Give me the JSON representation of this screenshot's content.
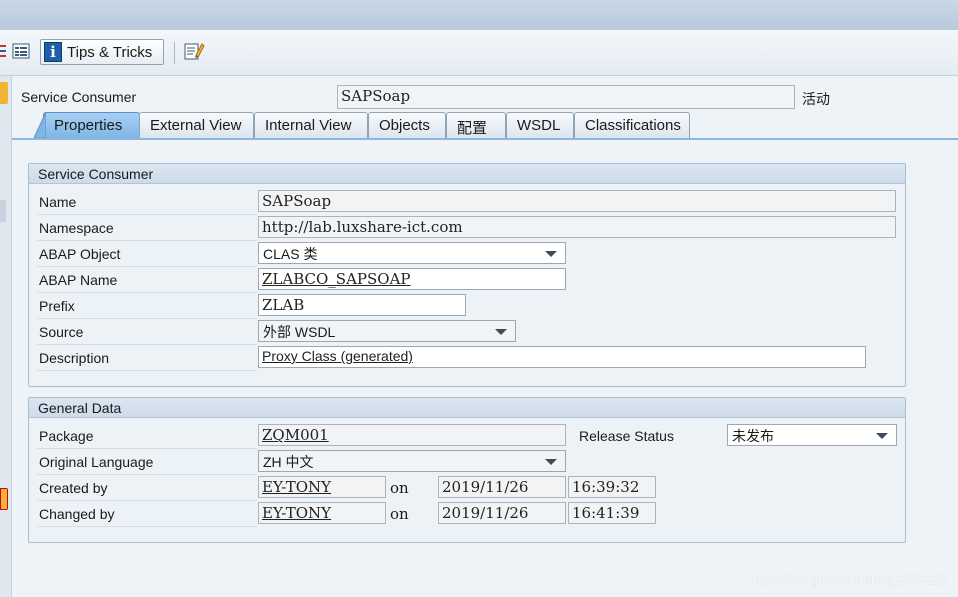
{
  "toolbar": {
    "tips_label": "Tips & Tricks"
  },
  "header": {
    "service_consumer_label": "Service Consumer",
    "service_consumer_value": "SAPSoap",
    "status_text": "活动"
  },
  "tabs": [
    {
      "label": "Properties",
      "active": true
    },
    {
      "label": "External View",
      "active": false
    },
    {
      "label": "Internal View",
      "active": false
    },
    {
      "label": "Objects",
      "active": false
    },
    {
      "label": "配置",
      "active": false
    },
    {
      "label": "WSDL",
      "active": false
    },
    {
      "label": "Classifications",
      "active": false
    }
  ],
  "service_consumer_group": {
    "title": "Service Consumer",
    "name_label": "Name",
    "name_value": "SAPSoap",
    "namespace_label": "Namespace",
    "namespace_value": "http://lab.luxshare-ict.com",
    "abap_object_label": "ABAP Object",
    "abap_object_value": "CLAS 类",
    "abap_name_label": "ABAP Name",
    "abap_name_value": "ZLABCO_SAPSOAP",
    "prefix_label": "Prefix",
    "prefix_value": "ZLAB",
    "source_label": "Source",
    "source_value": "外部 WSDL",
    "description_label": "Description",
    "description_value": "Proxy Class (generated)"
  },
  "general_data_group": {
    "title": "General Data",
    "package_label": "Package",
    "package_value": "ZQM001",
    "release_status_label": "Release Status",
    "release_status_value": "未发布",
    "orig_lang_label": "Original Language",
    "orig_lang_value": "ZH 中文",
    "created_by_label": "Created by",
    "created_by_value": "EY-TONY",
    "created_on_label": "on",
    "created_date": "2019/11/26",
    "created_time": "16:39:32",
    "changed_by_label": "Changed by",
    "changed_by_value": "EY-TONY",
    "changed_on_label": "on",
    "changed_date": "2019/11/26",
    "changed_time": "16:41:39"
  },
  "watermark": "https://blog.csdn.net/sq1986127",
  "colors": {
    "active_tab": "#7fb6e6",
    "titlebar": "#b7cadb",
    "accent_orange": "#f2b431"
  }
}
